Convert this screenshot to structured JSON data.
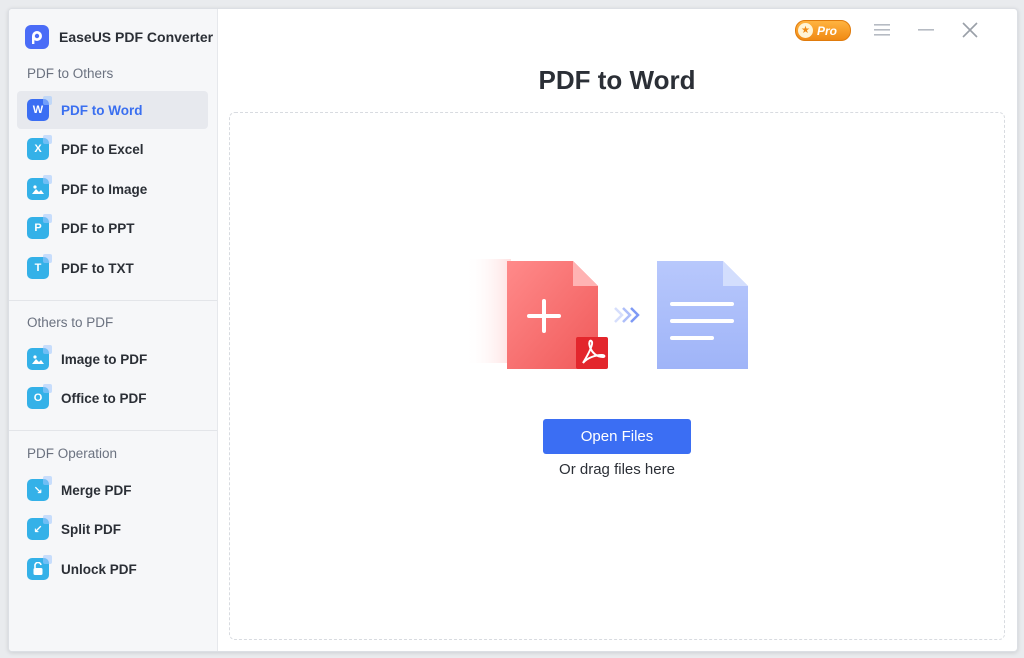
{
  "app": {
    "name": "EaseUS PDF Converter"
  },
  "sidebar": {
    "sections": [
      {
        "title": "PDF to Others",
        "items": [
          {
            "label": "PDF to Word",
            "icon": "word-icon",
            "glyph": "W",
            "active": true
          },
          {
            "label": "PDF to Excel",
            "icon": "excel-icon",
            "glyph": "X"
          },
          {
            "label": "PDF to Image",
            "icon": "image-icon",
            "glyph": ""
          },
          {
            "label": "PDF to PPT",
            "icon": "ppt-icon",
            "glyph": "P"
          },
          {
            "label": "PDF to TXT",
            "icon": "txt-icon",
            "glyph": "T"
          }
        ]
      },
      {
        "title": "Others to PDF",
        "items": [
          {
            "label": "Image to PDF",
            "icon": "image-icon",
            "glyph": ""
          },
          {
            "label": "Office to PDF",
            "icon": "office-icon",
            "glyph": "O"
          }
        ]
      },
      {
        "title": "PDF Operation",
        "items": [
          {
            "label": "Merge PDF",
            "icon": "merge-icon",
            "glyph": "↘"
          },
          {
            "label": "Split PDF",
            "icon": "split-icon",
            "glyph": "↙"
          },
          {
            "label": "Unlock PDF",
            "icon": "unlock-icon",
            "glyph": ""
          }
        ]
      }
    ]
  },
  "topbar": {
    "pro_label": "Pro"
  },
  "main": {
    "title": "PDF to Word",
    "open_button": "Open Files",
    "drag_hint": "Or drag files here"
  },
  "colors": {
    "accent": "#3b6ef3",
    "active_text": "#3a6ff0",
    "pro_orange": "#f08a14",
    "pdf_red": "#f26b6b",
    "doc_blue": "#a9bdfb"
  }
}
